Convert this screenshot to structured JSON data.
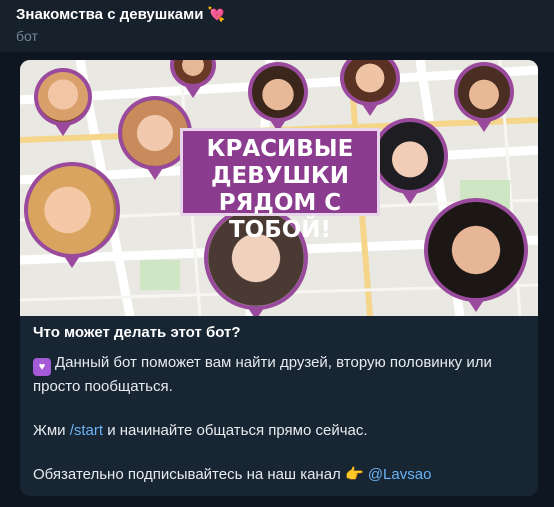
{
  "header": {
    "title": "Знакомства с девушками",
    "title_emoji": "💘",
    "subtitle": "бот"
  },
  "banner": {
    "title_line1": "КРАСИВЫЕ",
    "title_line2": "ДЕВУШКИ",
    "title_line3": "РЯДОМ С ТОБОЙ!"
  },
  "message": {
    "question": "Что может делать этот бот?",
    "line1_icon": "heart-icon",
    "line1": "Данный бот поможет вам найти друзей, вторую половинку или просто пообщаться.",
    "line2_prefix": "Жми ",
    "line2_command": "/start",
    "line2_suffix": " и начинайте общаться прямо сейчас.",
    "line3_prefix": "Обязательно подписывайтесь на наш канал ",
    "line3_emoji": "👉",
    "line3_link": "@Lavsao"
  },
  "colors": {
    "background": "#0e1621",
    "header": "#17212b",
    "card": "#182533",
    "link": "#6ab3f3",
    "pin_purple": "#9a4a9c"
  }
}
